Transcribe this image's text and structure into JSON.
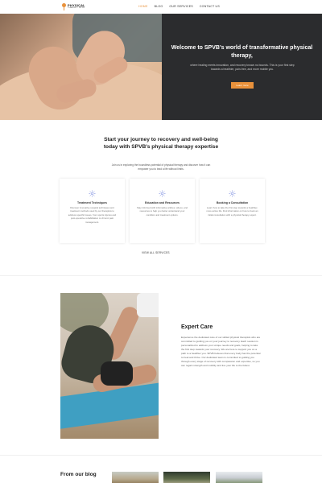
{
  "brand": {
    "name_line1": "PHYSICAL",
    "name_line2": "THERAPY SPVB",
    "accent_color": "#e8913b",
    "dark_color": "#2b2c2e"
  },
  "nav": {
    "items": [
      {
        "label": "HOME",
        "active": true
      },
      {
        "label": "BLOG",
        "active": false
      },
      {
        "label": "OUR SERVICES",
        "active": false
      },
      {
        "label": "CONTACT US",
        "active": false
      }
    ]
  },
  "hero": {
    "title": "Welcome to SPVB's world of transformative physical therapy,",
    "text": "where healing meets innovation, and recovery knows no bounds. This is your first step towards a healthier, pain-free, and more mobile you.",
    "button_label": "Learn more"
  },
  "intro": {
    "title": "Start your journey to recovery and well-being today with SPVB's physical therapy expertise",
    "text": "Join us in exploring the boundless potential of physical therapy and discover how it can empower you to lead a life without limits.",
    "cards": [
      {
        "icon": "sparkle-icon",
        "title": "Treatment Techniques",
        "text": "Discover innovative surgical techniques and treatment methods used by our therapists to address specific issues, from sports injuries and post-operative rehabilitation to chronic pain management."
      },
      {
        "icon": "sparkle-icon",
        "title": "Education and Resources",
        "text": "Stay informed with informative articles, videos, and resources to help you better understand your condition and treatment options."
      },
      {
        "icon": "sparkle-icon",
        "title": "Booking a Consultation",
        "text": "Learn how to take the first step towards a healthier, more active life. Find information on how to book an initial consultation with a physical therapy expert."
      }
    ],
    "view_services_label": "VIEW ALL SERVICES"
  },
  "expert": {
    "title": "Expert Care",
    "text": "Experience the dedicated care of our skilled physical therapists who are committed to guiding you on your journey to recovery. Each session is personalized to address your unique needs and goals, helping to take the first step towards your recovery. We are here to support you on a path to a healthier you. SPVB believes that every body has the potential to heal and thrive. Our dedicated team is committed to guiding you through every stage of recovery with compassion and expertise, so you can regain strength and mobility and live your life to the fullest."
  },
  "blog": {
    "title": "From our blog"
  }
}
